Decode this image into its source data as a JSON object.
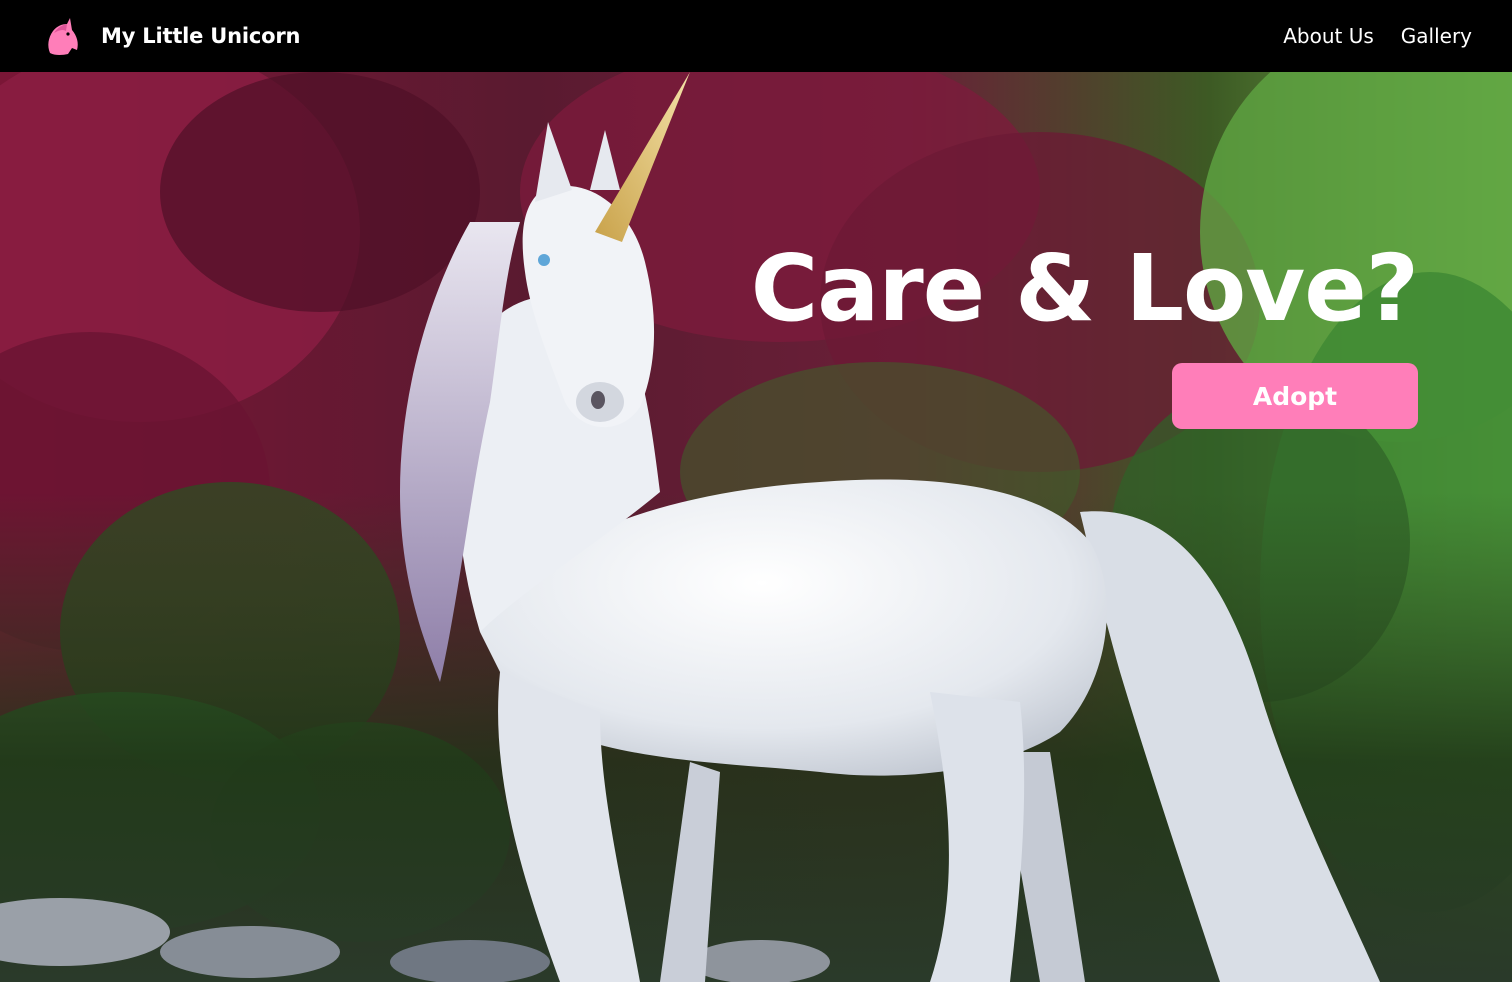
{
  "header": {
    "brand_name": "My Little Unicorn",
    "logo_icon": "unicorn-head-icon",
    "nav": [
      {
        "label": "About Us"
      },
      {
        "label": "Gallery"
      }
    ]
  },
  "hero": {
    "title": "Care & Love?",
    "cta_label": "Adopt",
    "background_image": "white unicorn standing in a forest"
  },
  "colors": {
    "navbar_bg": "#000000",
    "accent_pink": "#ff7eb9",
    "text_white": "#ffffff"
  }
}
